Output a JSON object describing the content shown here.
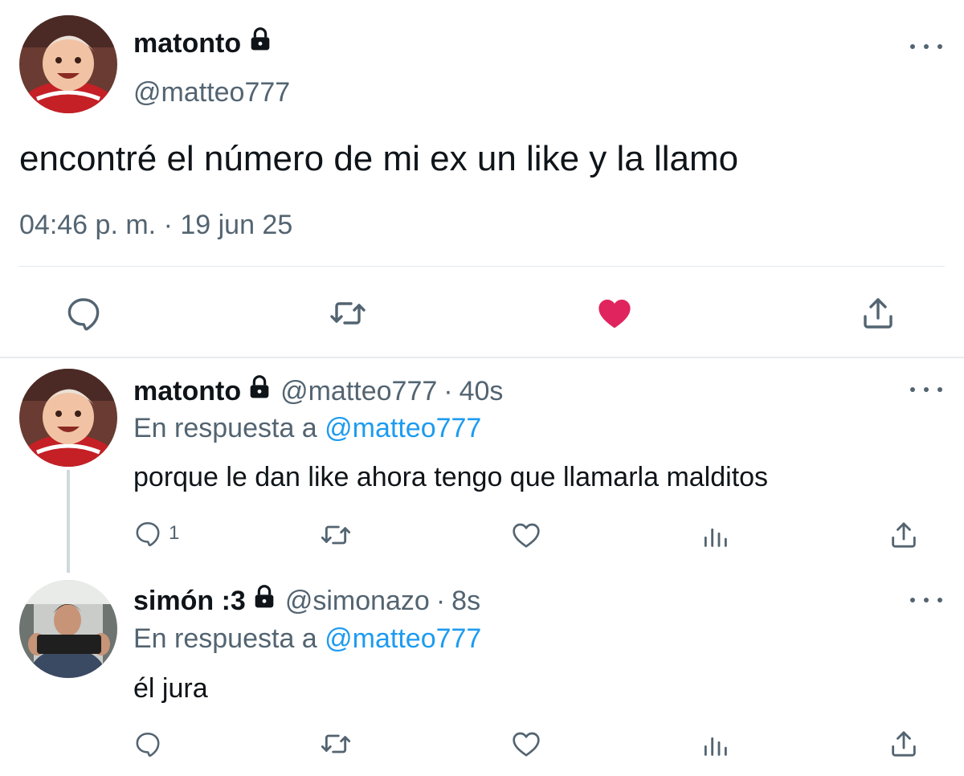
{
  "main_tweet": {
    "display_name": "matonto",
    "handle": "@matteo777",
    "text": "encontré el número de mi ex un like y la llamo",
    "time": "04:46 p. m.",
    "separator": "·",
    "date": "19 jun 25",
    "liked": true
  },
  "replies": [
    {
      "display_name": "matonto",
      "handle": "@matteo777",
      "separator": "·",
      "age": "40s",
      "reply_prefix": "En respuesta a",
      "reply_to": "@matteo777",
      "text": "porque le dan like ahora tengo que llamarla malditos",
      "reply_count": "1"
    },
    {
      "display_name": "simón :3",
      "handle": "@simonazo",
      "separator": "·",
      "age": "8s",
      "reply_prefix": "En respuesta a",
      "reply_to": "@matteo777",
      "text": "él jura"
    }
  ],
  "colors": {
    "like_active": "#e0245e",
    "link": "#1d9bf0",
    "secondary_text": "#536471"
  },
  "icons": [
    "lock-icon",
    "more-icon",
    "reply-icon",
    "retweet-icon",
    "heart-icon",
    "share-icon",
    "analytics-icon"
  ]
}
